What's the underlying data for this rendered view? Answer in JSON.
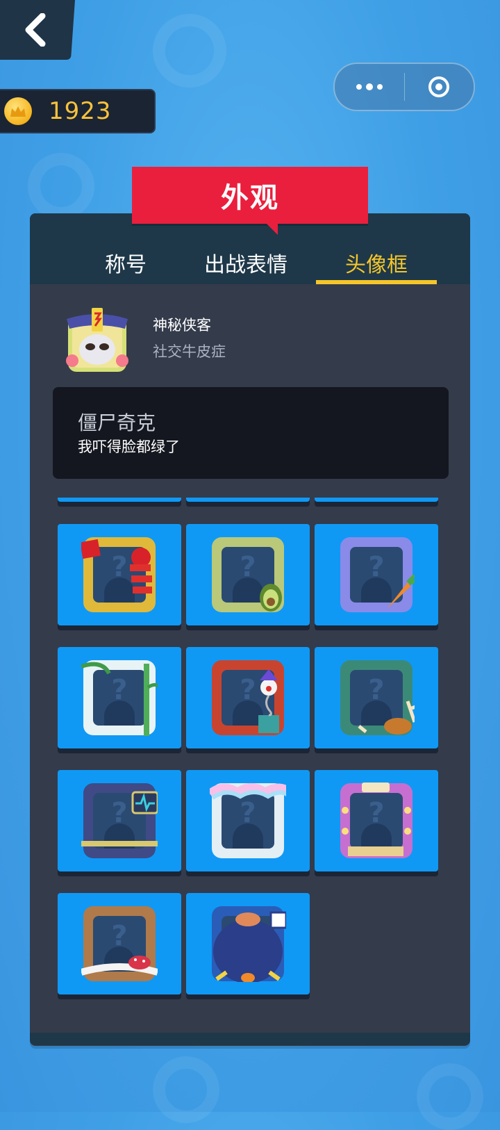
{
  "coins": {
    "value": "1923"
  },
  "banner": {
    "title": "外观"
  },
  "tabs": [
    {
      "label": "称号",
      "active": false
    },
    {
      "label": "出战表情",
      "active": false
    },
    {
      "label": "头像框",
      "active": true
    }
  ],
  "profile": {
    "name": "神秘侠客",
    "title": "社交牛皮症"
  },
  "selected": {
    "name": "僵尸奇克",
    "description": "我吓得脸都绿了"
  },
  "frames": [
    {
      "name": "firecracker-frame",
      "frame_color": "#e0b93a",
      "deco": "firecracker"
    },
    {
      "name": "avocado-frame",
      "frame_color": "#b9c879",
      "deco": "avocado"
    },
    {
      "name": "carrot-frame",
      "frame_color": "#8a8ae8",
      "deco": "carrot"
    },
    {
      "name": "bamboo-frame",
      "frame_color": "#e8f3f5",
      "deco": "bamboo"
    },
    {
      "name": "jester-box-frame",
      "frame_color": "#c9442f",
      "deco": "jester"
    },
    {
      "name": "coral-frame",
      "frame_color": "#3b8a78",
      "deco": "coral"
    },
    {
      "name": "monitor-frame",
      "frame_color": "#3f4a86",
      "deco": "monitor"
    },
    {
      "name": "rainbow-cloud-frame",
      "frame_color": "#e4eef5",
      "deco": "rainbow"
    },
    {
      "name": "toy-machine-frame",
      "frame_color": "#c66fd0",
      "deco": "toy"
    },
    {
      "name": "donut-frame",
      "frame_color": "#b07a4a",
      "deco": "donut"
    },
    {
      "name": "penguin-frame",
      "frame_color": "#2a5db8",
      "deco": "penguin"
    }
  ],
  "colors": {
    "accent": "#f5c52a",
    "banner": "#ea1f3d",
    "cell": "#0f99f5",
    "panel": "#343b4b"
  },
  "icons": {
    "back": "chevron-left-icon",
    "coin": "crown-coin-icon",
    "more": "more-dots-icon",
    "close": "target-circle-icon"
  }
}
